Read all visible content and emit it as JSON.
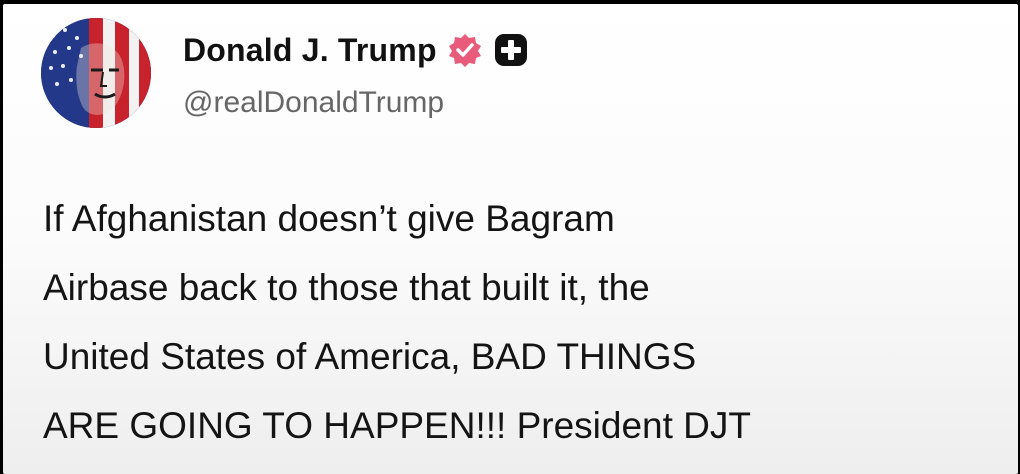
{
  "post": {
    "author": {
      "display_name": "Donald J. Trump",
      "handle": "@realDonaldTrump",
      "avatar_icon": "avatar-flag-portrait",
      "verified_badge_icon": "verified-badge-icon",
      "verified_badge_color": "#e85b7a",
      "plus_badge_icon": "plus-badge-icon",
      "plus_badge_color": "#111111"
    },
    "body_lines": [
      "If Afghanistan doesn’t give Bagram",
      "Airbase back to those that built it, the",
      "United States of America, BAD THINGS",
      "ARE GOING TO HAPPEN!!! President DJT"
    ]
  },
  "colors": {
    "card_background": "#ffffff",
    "text_primary": "#141414",
    "text_secondary": "#666666"
  }
}
